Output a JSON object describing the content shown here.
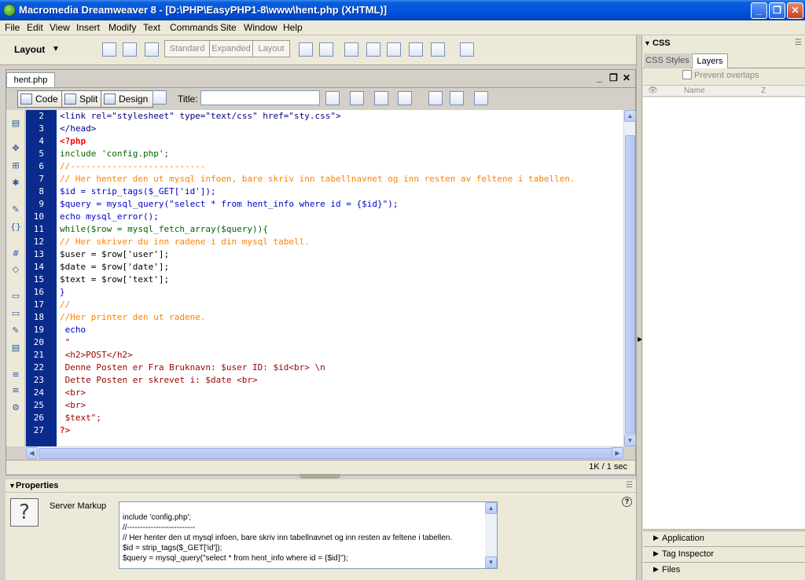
{
  "window": {
    "title": "Macromedia Dreamweaver 8 - [D:\\PHP\\EasyPHP1-8\\www\\hent.php (XHTML)]"
  },
  "menu": [
    "File",
    "Edit",
    "View",
    "Insert",
    "Modify",
    "Text",
    "Commands",
    "Site",
    "Window",
    "Help"
  ],
  "insert_bar": {
    "category": "Layout",
    "modes": [
      "Standard",
      "Expanded",
      "Layout"
    ]
  },
  "document": {
    "tab": "hent.php",
    "views": {
      "code": "Code",
      "split": "Split",
      "design": "Design"
    },
    "title_label": "Title:",
    "title_value": "",
    "status_size": "1K / 1 sec"
  },
  "code": {
    "line_numbers": [
      "2",
      "3",
      "4",
      "5",
      "6",
      "7",
      "8",
      "9",
      "10",
      "11",
      "12",
      "13",
      "14",
      "15",
      "16",
      "17",
      "18",
      "19",
      "20",
      "21",
      "22",
      "23",
      "24",
      "25",
      "26",
      "27"
    ],
    "lines": [
      "<link rel=\"stylesheet\" type=\"text/css\" href=\"sty.css\">",
      "</head>",
      "<?php",
      "include 'config.php';",
      "//--------------------------",
      "// Her henter den ut mysql infoen, bare skriv inn tabellnavnet og inn resten av feltene i tabellen.",
      "$id = strip_tags($_GET['id']);",
      "$query = mysql_query(\"select * from hent_info where id = {$id}\");",
      "echo mysql_error();",
      "while($row = mysql_fetch_array($query)){",
      "// Her skriver du inn radene i din mysql tabell.",
      "$user = $row['user'];",
      "$date = $row['date'];",
      "$text = $row['text'];",
      "}",
      "//",
      "//Her printer den ut radene.",
      " echo",
      " \"",
      " <h2>POST</h2>",
      " Denne Posten er Fra Bruknavn: $user ID: $id<br> \\n",
      " Dette Posten er skrevet i: $date <br>",
      " <br>",
      " <br>",
      " $text\";",
      "?>"
    ]
  },
  "properties": {
    "title": "Properties",
    "label": "Server Markup",
    "code_lines": [
      "",
      "include 'config.php';",
      "//--------------------------",
      "// Her henter den ut mysql infoen, bare skriv inn tabellnavnet og inn resten av feltene i tabellen.",
      "$id = strip_tags($_GET['id']);",
      "$query = mysql_query(\"select * from hent_info where id = {$id}\");"
    ]
  },
  "right_panel": {
    "css_title": "CSS",
    "tabs": [
      "CSS Styles",
      "Layers"
    ],
    "active_tab": "Layers",
    "prevent_overlaps": "Prevent overlaps",
    "columns": [
      "Name",
      "Z"
    ],
    "groups": [
      "Application",
      "Tag Inspector",
      "Files"
    ]
  },
  "colors": {
    "titlebar": "#0254e0",
    "gutter": "#0a2a8c",
    "php_delim": "#ff0000",
    "comment": "#ff8000",
    "keyword": "#006600",
    "function": "#0000cc",
    "string": "#cc0000"
  }
}
